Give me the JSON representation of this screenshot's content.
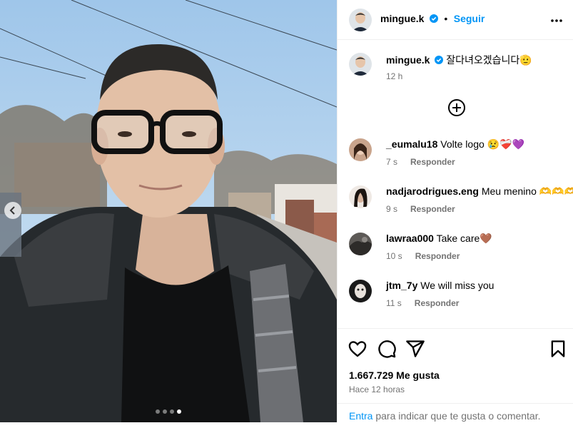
{
  "post": {
    "author": "mingue.k",
    "verified": true,
    "follow_label": "Seguir",
    "separator": "•",
    "caption": "잘다녀오겠습니다🫡",
    "caption_time": "12 h",
    "carousel": {
      "total": 4,
      "active_index": 4
    }
  },
  "comments": [
    {
      "user": "_eumalu18",
      "text": "Volte logo 😢❤️‍🩹💜",
      "time": "7 s",
      "reply": "Responder"
    },
    {
      "user": "nadjarodrigues.eng",
      "text": "Meu menino 🫶🫶🫶",
      "time": "9 s",
      "reply": "Responder"
    },
    {
      "user": "lawraa000",
      "text": "Take care🤎",
      "time": "10 s",
      "reply": "Responder"
    },
    {
      "user": "jtm_7y",
      "text": "We will miss you",
      "time": "11 s",
      "reply": "Responder"
    }
  ],
  "footer": {
    "likes": "1.667.729 Me gusta",
    "posted": "Hace 12 horas",
    "login_link": "Entra",
    "login_rest": " para indicar que te gusta o comentar."
  },
  "colors": {
    "accent": "#0095f6",
    "muted": "#737373",
    "border": "#efefef"
  },
  "icons": [
    "chevron-left-icon",
    "more-icon",
    "verified-badge-icon",
    "add-circle-icon",
    "heart-icon",
    "comment-icon",
    "share-icon",
    "bookmark-icon"
  ]
}
